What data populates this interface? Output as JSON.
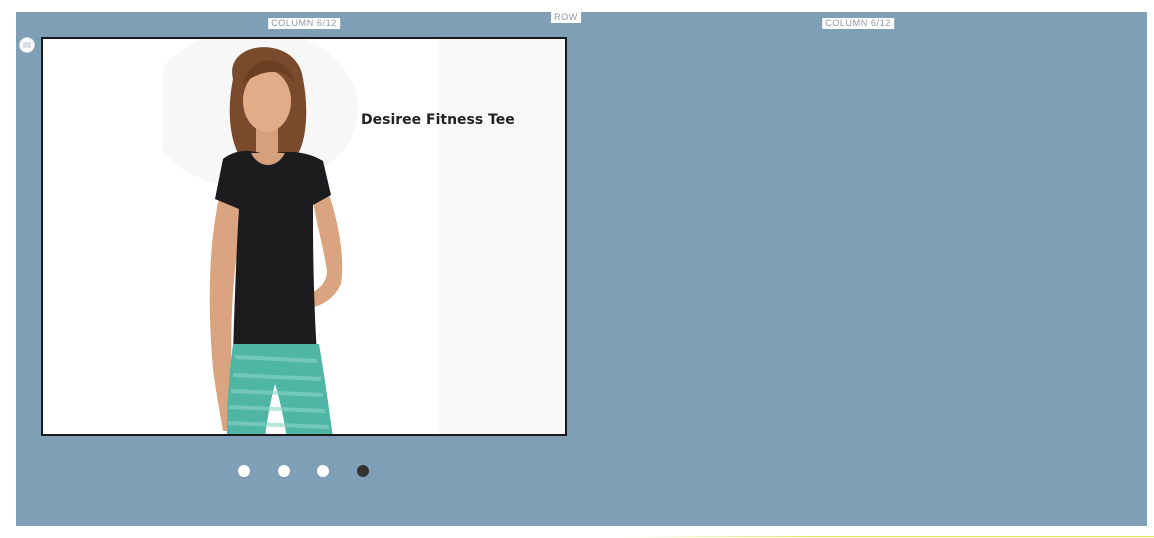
{
  "row": {
    "label": "ROW"
  },
  "columns": [
    {
      "label": "COLUMN 6/12"
    },
    {
      "label": "COLUMN 6/12"
    }
  ],
  "slider": {
    "slides": [
      {
        "title": "Desiree Fitness Tee"
      }
    ],
    "dot_count": 4,
    "active_dot": 4
  },
  "right_column": {
    "placeholder": ""
  },
  "colors": {
    "row_background": "#7f9fb7",
    "active_dot": "#333333",
    "inactive_dot": "#ffffff"
  },
  "icons": {
    "drag_handle": "drag-handle-icon"
  }
}
